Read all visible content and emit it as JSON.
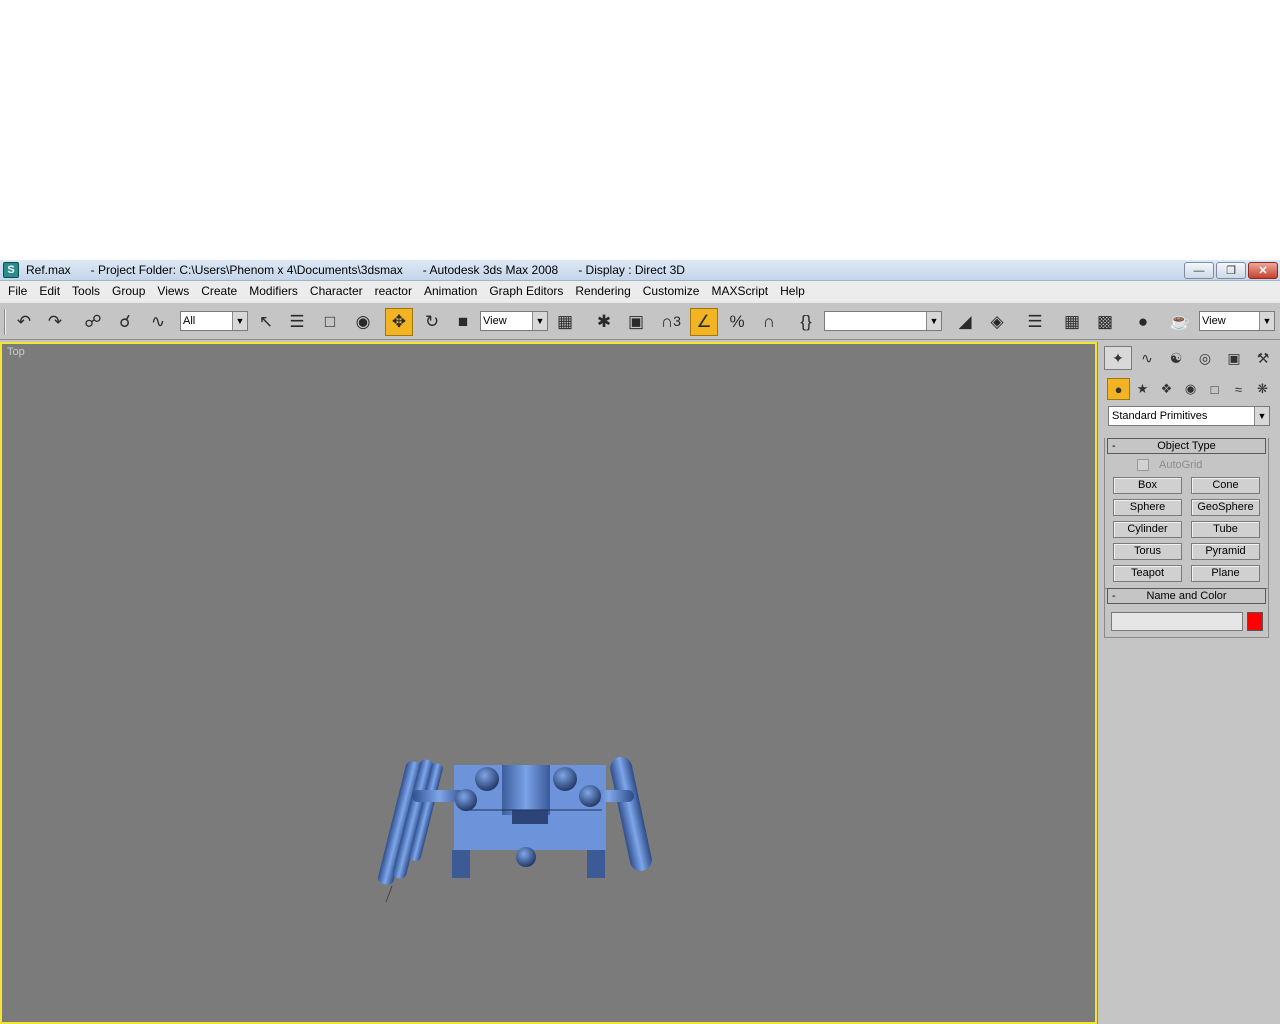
{
  "window": {
    "title": "Ref.max      - Project Folder: C:\\Users\\Phenom x 4\\Documents\\3dsmax      - Autodesk 3ds Max 2008      - Display : Direct 3D",
    "app_icon": "3ds-max-icon"
  },
  "menu": [
    "File",
    "Edit",
    "Tools",
    "Group",
    "Views",
    "Create",
    "Modifiers",
    "Character",
    "reactor",
    "Animation",
    "Graph Editors",
    "Rendering",
    "Customize",
    "MAXScript",
    "Help"
  ],
  "toolbar": {
    "selection_filter": "All",
    "reference_coord": "View",
    "named_selection": "",
    "render_type": "View",
    "active_tool": "select-and-move",
    "snap_toggle": "3"
  },
  "viewport": {
    "label": "Top",
    "border_color": "#f4e42c",
    "background": "#7b7b7b",
    "model_color": "#6a93d9"
  },
  "command_panel": {
    "active_tab": "create",
    "active_category": "geometry",
    "category_dropdown": "Standard Primitives",
    "object_type": {
      "title": "Object Type",
      "collapse": "-",
      "autogrid_label": "AutoGrid",
      "buttons": [
        "Box",
        "Cone",
        "Sphere",
        "GeoSphere",
        "Cylinder",
        "Tube",
        "Torus",
        "Pyramid",
        "Teapot",
        "Plane"
      ]
    },
    "name_and_color": {
      "title": "Name and Color",
      "collapse": "-",
      "name_value": "",
      "color": "#ff0000"
    }
  }
}
